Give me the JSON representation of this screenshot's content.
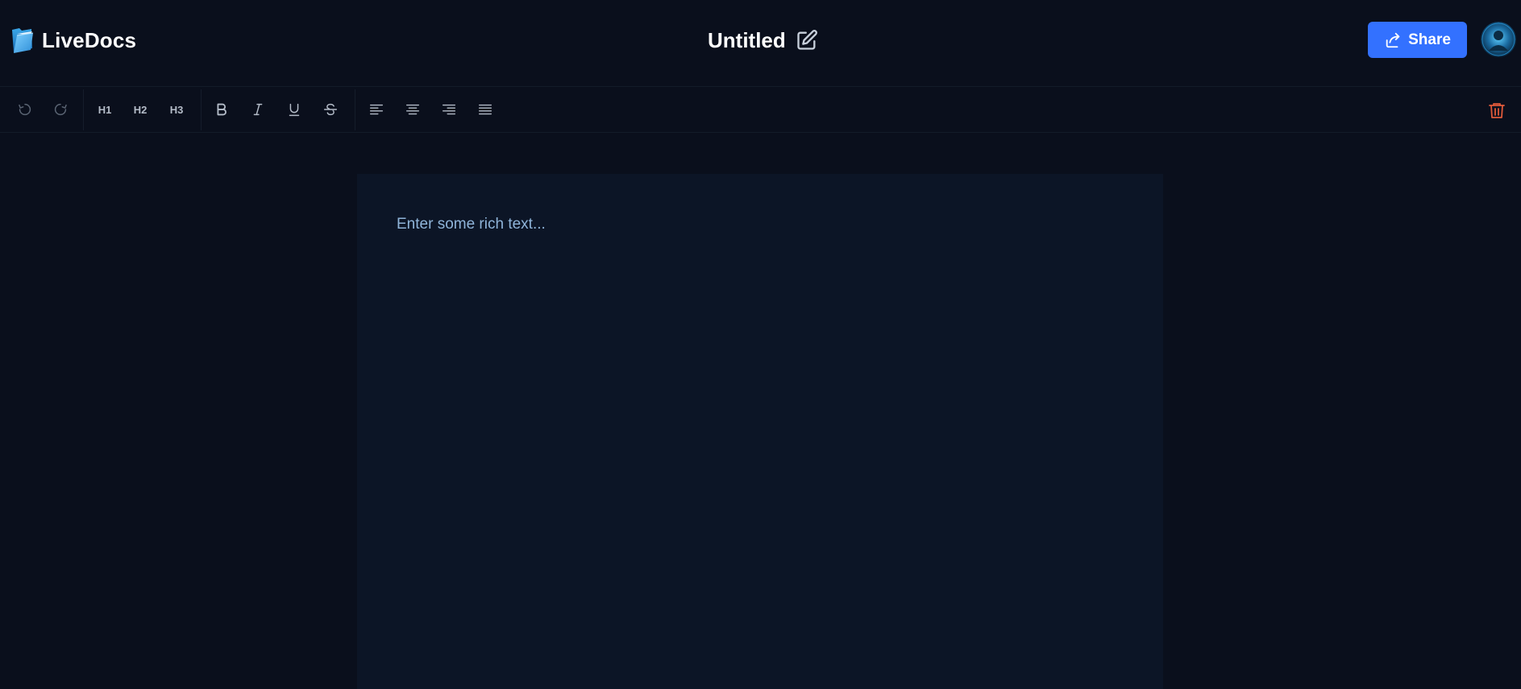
{
  "header": {
    "brand_name": "LiveDocs",
    "document_title": "Untitled",
    "share_label": "Share"
  },
  "toolbar": {
    "undo_icon": "undo-icon",
    "redo_icon": "redo-icon",
    "headings": [
      {
        "label": "H1"
      },
      {
        "label": "H2"
      },
      {
        "label": "H3"
      }
    ],
    "format_icons": [
      "bold-icon",
      "italic-icon",
      "underline-icon",
      "strikethrough-icon"
    ],
    "align_icons": [
      "align-left-icon",
      "align-center-icon",
      "align-right-icon",
      "align-justify-icon"
    ],
    "delete_icon": "trash-icon"
  },
  "editor": {
    "placeholder": "Enter some rich text..."
  },
  "colors": {
    "background": "#0a0f1c",
    "editor_background": "#0c1526",
    "accent": "#3371ff",
    "danger": "#e05a3a",
    "placeholder_text": "#8fb4d9",
    "toolbar_icon": "#b4bcc8"
  }
}
